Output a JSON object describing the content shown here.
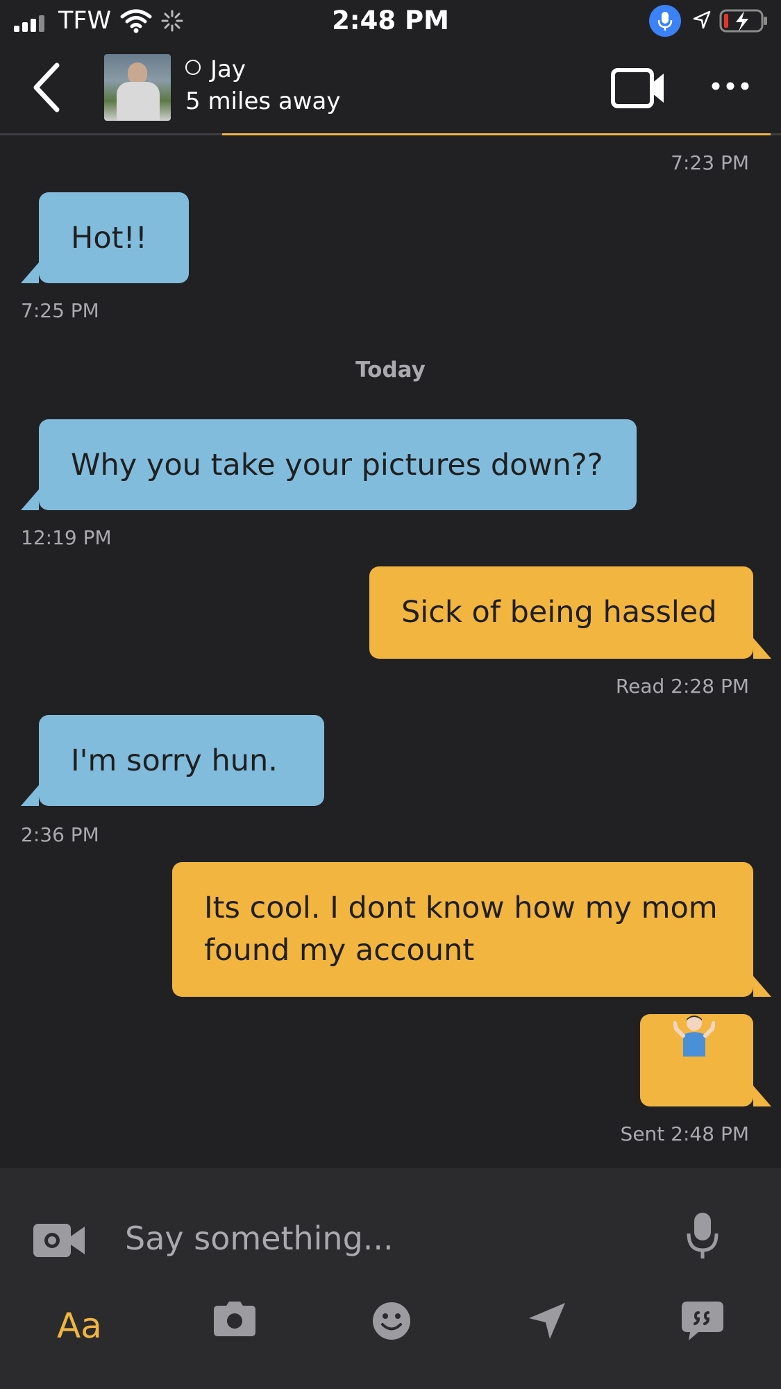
{
  "status_bar": {
    "carrier": "TFW",
    "time": "2:48 PM"
  },
  "header": {
    "contact_name": "Jay",
    "distance": "5 miles away"
  },
  "messages": [
    {
      "type": "timestamp",
      "text": "7:23 PM"
    },
    {
      "type": "incoming",
      "text": "Hot!!",
      "time": "7:25 PM"
    },
    {
      "type": "divider",
      "text": "Today"
    },
    {
      "type": "incoming",
      "text": "Why you take your pictures down??",
      "time": "12:19 PM"
    },
    {
      "type": "outgoing",
      "text": "Sick of being hassled",
      "status": "Read 2:28 PM"
    },
    {
      "type": "incoming",
      "text": "I'm sorry hun.",
      "time": "2:36 PM"
    },
    {
      "type": "outgoing",
      "text_line1": "Its cool. I dont know how my mom",
      "text_line2": "found my account"
    },
    {
      "type": "outgoing",
      "emoji": "man-shrugging",
      "status": "Sent 2:48 PM"
    }
  ],
  "composer": {
    "placeholder": "Say something...",
    "text_style_label": "Aa"
  },
  "colors": {
    "background": "#212124",
    "incoming_bubble": "#82bcdc",
    "outgoing_bubble": "#f2b540",
    "accent": "#f0b540",
    "muted_text": "#a9a9ae"
  }
}
